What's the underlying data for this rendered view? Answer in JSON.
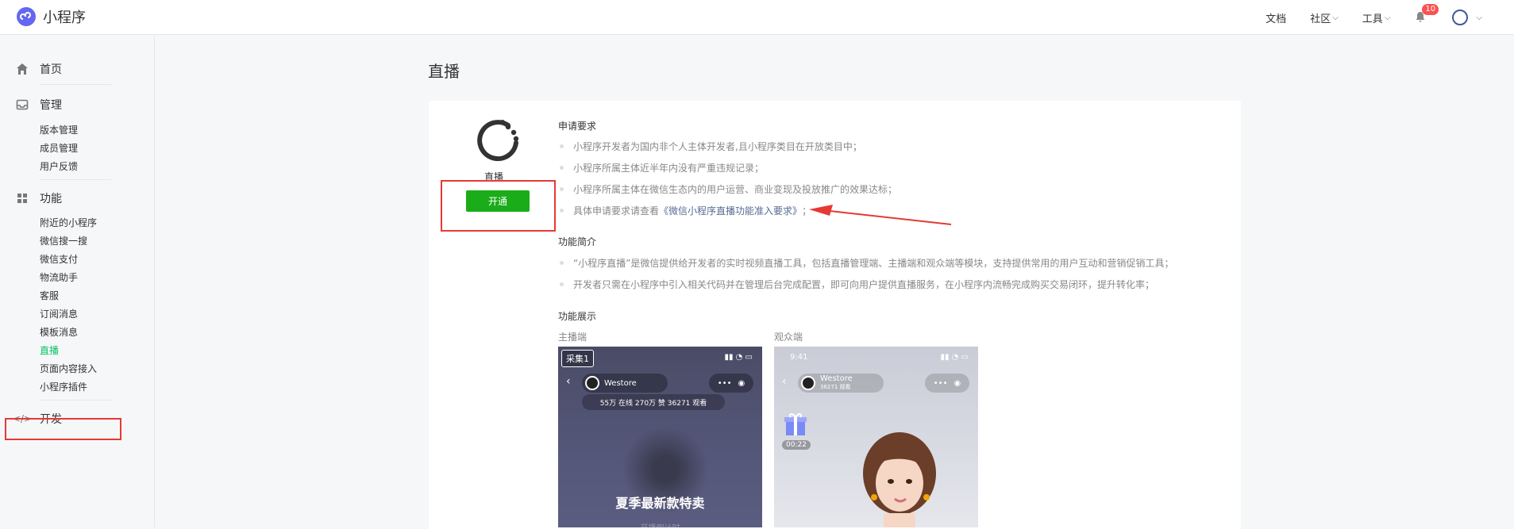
{
  "app": {
    "title": "小程序"
  },
  "topnav": {
    "docs": "文档",
    "community": "社区",
    "tools": "工具",
    "notify_count": "10"
  },
  "sidebar": {
    "home": "首页",
    "manage": "管理",
    "manage_items": [
      "版本管理",
      "成员管理",
      "用户反馈"
    ],
    "features": "功能",
    "feature_items": [
      "附近的小程序",
      "微信搜一搜",
      "微信支付",
      "物流助手",
      "客服",
      "订阅消息",
      "模板消息",
      "直播",
      "页面内容接入",
      "小程序插件"
    ],
    "dev": "开发"
  },
  "page": {
    "title": "直播"
  },
  "plugin": {
    "name": "直播",
    "open_label": "开通"
  },
  "requirements": {
    "title": "申请要求",
    "items": [
      "小程序开发者为国内非个人主体开发者,且小程序类目在开放类目中；",
      "小程序所属主体近半年内没有严重违规记录；",
      "小程序所属主体在微信生态内的用户运营、商业变现及投放推广的效果达标；"
    ],
    "link_prefix": "具体申请要求请查看",
    "link_text": "《微信小程序直播功能准入要求》",
    "link_suffix": "；"
  },
  "intro": {
    "title": "功能简介",
    "items": [
      "“小程序直播”是微信提供给开发者的实时视频直播工具，包括直播管理端、主播端和观众端等模块，支持提供常用的用户互动和营销促销工具；",
      "开发者只需在小程序中引入相关代码并在管理后台完成配置，即可向用户提供直播服务，在小程序内流畅完成购买交易闭环，提升转化率；"
    ]
  },
  "demo": {
    "title": "功能展示",
    "anchor_label": "主播端",
    "viewer_label": "观众端",
    "anchor_screen": {
      "tag": "采集1",
      "store": "Westore",
      "stats": "55万 在线  270万 赞  36271 观看",
      "promo": "夏季最新款特卖",
      "promo_sub": "开播倒计时"
    },
    "viewer_screen": {
      "time": "9:41",
      "store": "Westore",
      "viewers": "36271 观看",
      "timer": "00:22"
    }
  },
  "colors": {
    "brand_green": "#1aad19",
    "active_green": "#07c160",
    "link": "#576b95",
    "annotation_red": "#e53935",
    "badge_red": "#fa5151"
  }
}
